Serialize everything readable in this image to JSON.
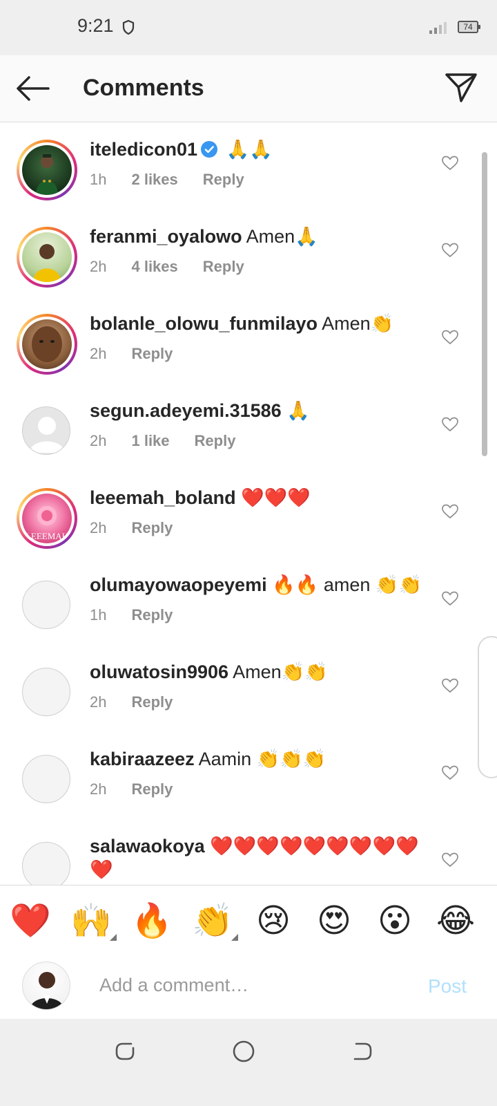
{
  "status_bar": {
    "time": "9:21",
    "battery": "74"
  },
  "header": {
    "title": "Comments"
  },
  "comments": [
    {
      "username": "iteledicon01",
      "verified": true,
      "text": "🙏🙏",
      "time": "1h",
      "likes": "2 likes",
      "reply": "Reply"
    },
    {
      "username": "feranmi_oyalowo",
      "verified": false,
      "text": "Amen🙏",
      "time": "2h",
      "likes": "4 likes",
      "reply": "Reply"
    },
    {
      "username": "bolanle_olowu_funmilayo",
      "verified": false,
      "text": "Amen👏",
      "time": "2h",
      "likes": "",
      "reply": "Reply"
    },
    {
      "username": "segun.adeyemi.31586",
      "verified": false,
      "text": "🙏",
      "time": "2h",
      "likes": "1 like",
      "reply": "Reply"
    },
    {
      "username": "leeemah_boland",
      "verified": false,
      "text": "❤️❤️❤️",
      "time": "2h",
      "likes": "",
      "reply": "Reply",
      "avatar_label": "LEEEMAH"
    },
    {
      "username": "olumayowaopeyemi",
      "verified": false,
      "text": "🔥🔥 amen 👏👏",
      "time": "1h",
      "likes": "",
      "reply": "Reply"
    },
    {
      "username": "oluwatosin9906",
      "verified": false,
      "text": "Amen👏👏",
      "time": "2h",
      "likes": "",
      "reply": "Reply"
    },
    {
      "username": "kabiraazeez",
      "verified": false,
      "text": "Aamin 👏👏👏",
      "time": "2h",
      "likes": "",
      "reply": "Reply"
    },
    {
      "username": "salawaokoya",
      "verified": false,
      "text": "❤️❤️❤️❤️❤️❤️❤️❤️❤️❤️",
      "time": "",
      "likes": "",
      "reply": ""
    }
  ],
  "emoji_bar": [
    "❤️",
    "🙌",
    "🔥",
    "👏",
    "😢",
    "😍",
    "😮",
    "😂"
  ],
  "composer": {
    "placeholder": "Add a comment…",
    "post_label": "Post"
  },
  "colors": {
    "post_disabled": "#b2dffc",
    "verified": "#3897f0",
    "ring_start": "#f58529",
    "ring_end": "#8134af"
  }
}
